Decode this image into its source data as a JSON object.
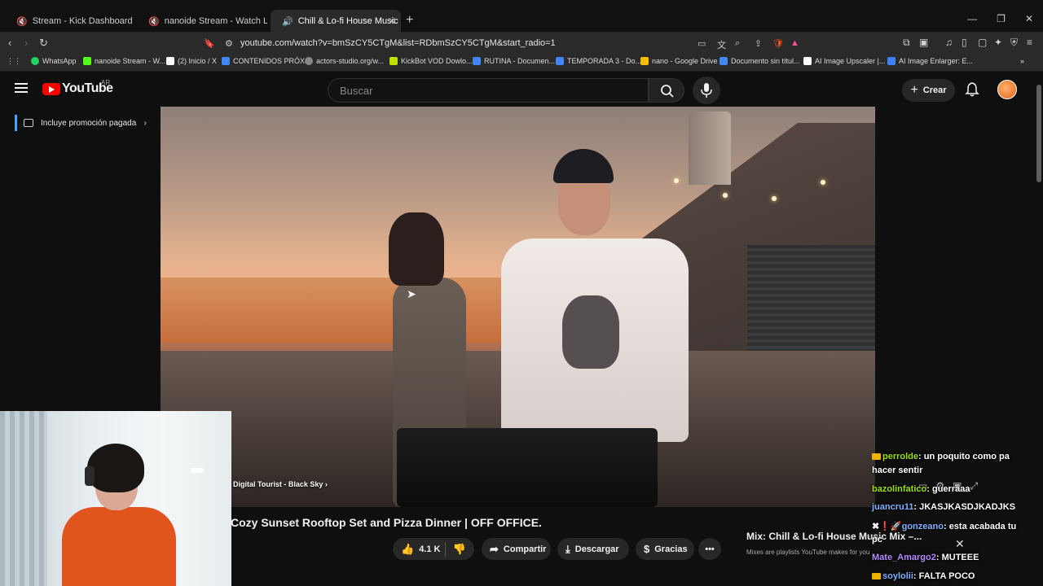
{
  "browser": {
    "tabs": [
      {
        "label": "Stream - Kick Dashboard",
        "favicon_color": "#53fc18"
      },
      {
        "label": "nanoide Stream - Watch Live on",
        "favicon_color": "#53fc18"
      },
      {
        "label": "Chill & Lo-fi House Music M",
        "favicon_color": "#ff0000",
        "active": true
      }
    ],
    "url": "youtube.com/watch?v=bmSzCY5CTgM&list=RDbmSzCY5CTgM&start_radio=1",
    "bookmarks": [
      {
        "label": "WhatsApp",
        "color": "#25d366"
      },
      {
        "label": "nanoide Stream - W...",
        "color": "#53fc18"
      },
      {
        "label": "(2) Inicio / X",
        "color": "#ffffff"
      },
      {
        "label": "CONTENIDOS PRÓX...",
        "color": "#4285f4"
      },
      {
        "label": "actors-studio.org/w...",
        "color": "#888888"
      },
      {
        "label": "KickBot VOD Dowlo...",
        "color": "#c0e000"
      },
      {
        "label": "RUTINA - Documen...",
        "color": "#4285f4"
      },
      {
        "label": "TEMPORADA 3 - Do...",
        "color": "#4285f4"
      },
      {
        "label": "nano - Google Drive",
        "color": "#fbbc05"
      },
      {
        "label": "Documento sin títul...",
        "color": "#4285f4"
      },
      {
        "label": "AI Image Upscaler |...",
        "color": "#ffffff"
      },
      {
        "label": "AI Image Enlarger: E...",
        "color": "#3b82f6"
      }
    ]
  },
  "youtube": {
    "logo_text": "YouTube",
    "country": "AR",
    "search_placeholder": "Buscar",
    "create_label": "Crear",
    "promo_label": "Incluye promoción pagada",
    "song_chip": "Digital Tourist - Black Sky",
    "video_title": "Cozy Sunset Rooftop Set and Pizza Dinner | OFF OFFICE.",
    "actions": {
      "likes": "4.1 K",
      "share": "Compartir",
      "download": "Descargar",
      "thanks": "Gracias"
    },
    "mix": {
      "title": "Mix: Chill & Lo-fi House Music Mix –...",
      "subtitle": "Mixes are playlists YouTube makes for you"
    }
  },
  "chat": [
    {
      "user": "perrolde",
      "text": "un poquito como pa",
      "cont": "hacer sentir",
      "color": "green",
      "badge": true
    },
    {
      "user": "bazolinfatico",
      "text": "guerraaa",
      "color": "green"
    },
    {
      "user": "juancru11",
      "text": "JKASJKASDJKADJKS",
      "color": "blue"
    },
    {
      "user": "gonzeano",
      "text": "esta acabada tu",
      "cont": "pc",
      "color": "blue",
      "emotes": "✖❗🚀"
    },
    {
      "user": "Mate_Amargo2",
      "text": "MUTEEE",
      "color": "purple"
    },
    {
      "user": "soylolii",
      "text": "FALTA POCO",
      "color": "blue",
      "crown": true
    }
  ]
}
